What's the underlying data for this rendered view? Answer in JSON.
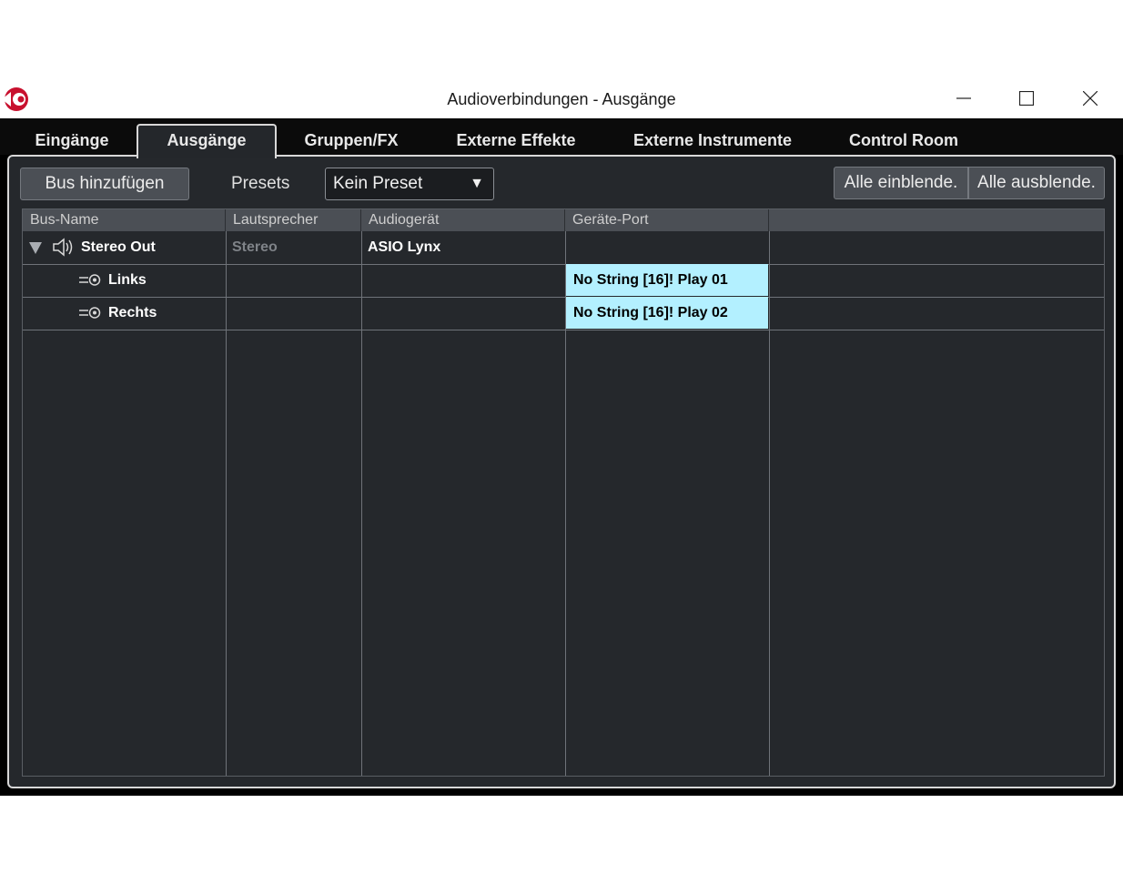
{
  "window": {
    "title": "Audioverbindungen - Ausgänge",
    "controls": {
      "minimize": "minimize-icon",
      "maximize": "maximize-icon",
      "close": "close-icon"
    }
  },
  "tabs": [
    {
      "label": "Eingänge",
      "active": false
    },
    {
      "label": "Ausgänge",
      "active": true
    },
    {
      "label": "Gruppen/FX",
      "active": false
    },
    {
      "label": "Externe Effekte",
      "active": false
    },
    {
      "label": "Externe Instrumente",
      "active": false
    },
    {
      "label": "Control Room",
      "active": false
    }
  ],
  "toolbar": {
    "add_bus_label": "Bus hinzufügen",
    "presets_label": "Presets",
    "preset_value": "Kein Preset",
    "show_all_label": "Alle einblende.",
    "hide_all_label": "Alle ausblende."
  },
  "table": {
    "columns": [
      "Bus-Name",
      "Lautsprecher",
      "Audiogerät",
      "Geräte-Port",
      ""
    ],
    "rows": [
      {
        "name": "Stereo Out",
        "speaker": "Stereo",
        "device": "ASIO Lynx",
        "port": ""
      },
      {
        "name": "Links",
        "speaker": "",
        "device": "",
        "port": "No String [16]! Play 01"
      },
      {
        "name": "Rechts",
        "speaker": "",
        "device": "",
        "port": "No String [16]! Play 02"
      }
    ]
  },
  "colors": {
    "accent_logo": "#c8102e",
    "port_highlight": "#b3f0ff",
    "panel_bg": "#25282c"
  }
}
